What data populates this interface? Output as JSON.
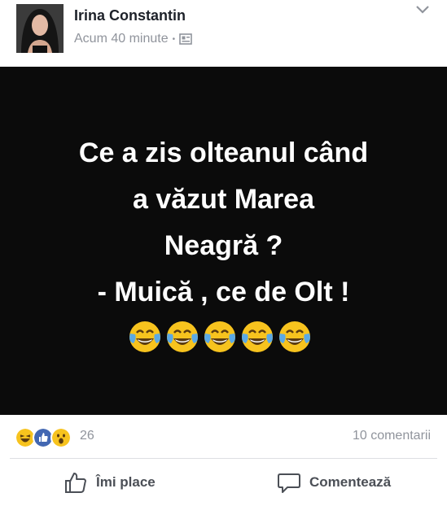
{
  "post": {
    "author": "Irina Constantin",
    "time": "Acum 40 minute",
    "separator": "•",
    "lines": [
      "Ce a zis olteanul când",
      "a văzut Marea",
      "Neagră ?",
      "- Muică , ce de Olt !"
    ],
    "emoji_count": 5,
    "emoji_name": "face-with-tears-of-joy"
  },
  "stats": {
    "reaction_icons": [
      "haha-icon",
      "like-icon",
      "wow-icon"
    ],
    "reaction_count": "26",
    "comments": "10 comentarii"
  },
  "actions": {
    "like": "Îmi place",
    "comment": "Comentează"
  },
  "colors": {
    "like_blue": "#4267b2",
    "reaction_yellow": "#f7c31e",
    "meta_gray": "#90949c",
    "post_background": "#0b0b0b"
  }
}
